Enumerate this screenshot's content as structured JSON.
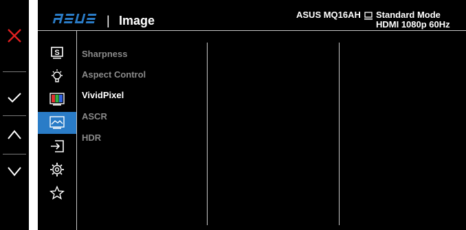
{
  "header": {
    "brand": "ASUS",
    "separator": "|",
    "title": "Image",
    "model": "ASUS MQ16AH",
    "mode": "Standard Mode",
    "signal": "HDMI  1080p 60Hz"
  },
  "keys": [
    {
      "name": "close-icon",
      "color": "#e02020"
    },
    {
      "name": "check-icon",
      "color": "#ffffff"
    },
    {
      "name": "chevron-up-icon",
      "color": "#ffffff"
    },
    {
      "name": "chevron-down-icon",
      "color": "#ffffff"
    }
  ],
  "nav": [
    {
      "name": "splendid-icon",
      "label": "S"
    },
    {
      "name": "bulb-icon"
    },
    {
      "name": "color-icon"
    },
    {
      "name": "image-icon",
      "selected": true
    },
    {
      "name": "input-select-icon"
    },
    {
      "name": "system-setup-icon"
    },
    {
      "name": "star-icon"
    }
  ],
  "menu": {
    "items": [
      {
        "label": "Sharpness",
        "enabled": false
      },
      {
        "label": "Aspect Control",
        "enabled": false
      },
      {
        "label": "VividPixel",
        "enabled": true
      },
      {
        "label": "ASCR",
        "enabled": false
      },
      {
        "label": "HDR",
        "enabled": false
      }
    ]
  },
  "colors": {
    "accent": "#2a7cc7",
    "background": "#000000",
    "disabled_text": "#8a8a8a"
  }
}
